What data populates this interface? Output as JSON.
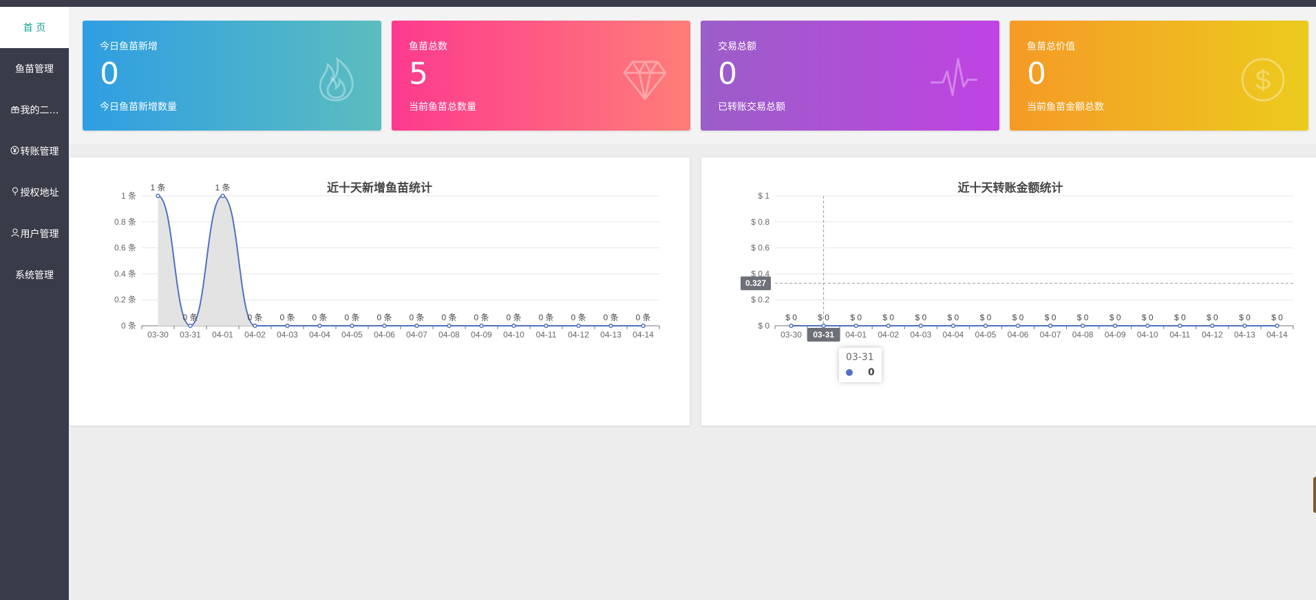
{
  "nav": [
    {
      "label": "首 页",
      "icon": "",
      "active": true
    },
    {
      "label": "鱼苗管理",
      "icon": ""
    },
    {
      "label": "我的二…",
      "icon": "gift-icon"
    },
    {
      "label": "转账管理",
      "icon": "yen-icon"
    },
    {
      "label": "授权地址",
      "icon": "location-pin-icon"
    },
    {
      "label": "用户管理",
      "icon": "user-icon"
    },
    {
      "label": "系统管理",
      "icon": ""
    }
  ],
  "cards": [
    {
      "title": "今日鱼苗新增",
      "value": "0",
      "desc": "今日鱼苗新增数量",
      "icon": "fire-icon",
      "color_from": "#2f9ee3",
      "color_to": "#5bbdbf"
    },
    {
      "title": "鱼苗总数",
      "value": "5",
      "desc": "当前鱼苗总数量",
      "icon": "diamond-icon",
      "color_from": "#fd3a8e",
      "color_to": "#ff7d78"
    },
    {
      "title": "交易总额",
      "value": "0",
      "desc": "已转账交易总额",
      "icon": "pulse-icon",
      "color_from": "#9b5ec8",
      "color_to": "#c043e2"
    },
    {
      "title": "鱼苗总价值",
      "value": "0",
      "desc": "当前鱼苗金额总数",
      "icon": "dollar-icon",
      "color_from": "#f59a26",
      "color_to": "#eccb1d"
    }
  ],
  "chart_data": [
    {
      "type": "line",
      "title": "近十天新增鱼苗统计",
      "categories": [
        "03-30",
        "03-31",
        "04-01",
        "04-02",
        "04-03",
        "04-04",
        "04-05",
        "04-06",
        "04-07",
        "04-08",
        "04-09",
        "04-10",
        "04-11",
        "04-12",
        "04-13",
        "04-14"
      ],
      "values": [
        1,
        0,
        1,
        0,
        0,
        0,
        0,
        0,
        0,
        0,
        0,
        0,
        0,
        0,
        0,
        0
      ],
      "ylim": [
        0,
        1
      ],
      "yticks": [
        "0 条",
        "0.2 条",
        "0.4 条",
        "0.6 条",
        "0.8 条",
        "1 条"
      ],
      "data_labels": [
        "1 条",
        "0 条",
        "1 条",
        "0 条",
        "0 条",
        "0 条",
        "0 条",
        "0 条",
        "0 条",
        "0 条",
        "0 条",
        "0 条",
        "0 条",
        "0 条",
        "0 条",
        "0 条"
      ],
      "smooth": true,
      "line_color": "#4f6ec0",
      "area_color": "#e3e3e3",
      "grid": true
    },
    {
      "type": "line",
      "title": "近十天转账金额统计",
      "categories": [
        "03-30",
        "03-31",
        "04-01",
        "04-02",
        "04-03",
        "04-04",
        "04-05",
        "04-06",
        "04-07",
        "04-08",
        "04-09",
        "04-10",
        "04-11",
        "04-12",
        "04-13",
        "04-14"
      ],
      "values": [
        0,
        0,
        0,
        0,
        0,
        0,
        0,
        0,
        0,
        0,
        0,
        0,
        0,
        0,
        0,
        0
      ],
      "ylim": [
        0,
        1
      ],
      "yticks": [
        "$ 0",
        "$ 0.2",
        "$ 0.4",
        "$ 0.6",
        "$ 0.8",
        "$ 1"
      ],
      "data_labels": [
        "$ 0",
        "$ 0",
        "$ 0",
        "$ 0",
        "$ 0",
        "$ 0",
        "$ 0",
        "$ 0",
        "$ 0",
        "$ 0",
        "$ 0",
        "$ 0",
        "$ 0",
        "$ 0",
        "$ 0",
        "$ 0"
      ],
      "line_color": "#4f6ec0",
      "grid": true,
      "crosshair": {
        "x_label": "03-31",
        "y_label": "0.327",
        "y_value": 0.327,
        "category_index": 1
      },
      "tooltip": {
        "title": "03-31",
        "value": "0"
      }
    }
  ]
}
